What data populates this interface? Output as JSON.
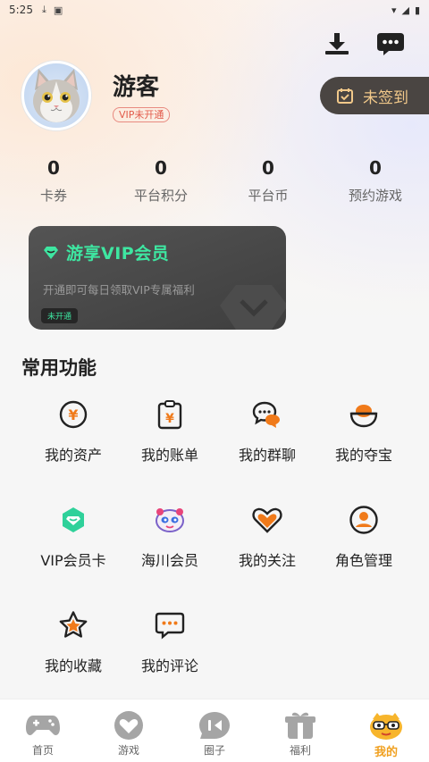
{
  "status_bar": {
    "time": "5:25"
  },
  "profile": {
    "username": "游客",
    "vip_tag": "VIP未开通",
    "checkin_label": "未签到"
  },
  "stats": [
    {
      "value": "0",
      "label": "卡券"
    },
    {
      "value": "0",
      "label": "平台积分"
    },
    {
      "value": "0",
      "label": "平台币"
    },
    {
      "value": "0",
      "label": "预约游戏"
    }
  ],
  "vip_card": {
    "title": "游享VIP会员",
    "desc": "开通即可每日领取VIP专属福利",
    "state": "未开通"
  },
  "section": {
    "title": "常用功能"
  },
  "features": [
    {
      "label": "我的资产",
      "icon": "yuan-coin-icon"
    },
    {
      "label": "我的账单",
      "icon": "bill-icon"
    },
    {
      "label": "我的群聊",
      "icon": "group-chat-icon"
    },
    {
      "label": "我的夺宝",
      "icon": "treasure-icon"
    },
    {
      "label": "VIP会员卡",
      "icon": "vip-card-icon"
    },
    {
      "label": "海川会员",
      "icon": "haichuan-member-icon"
    },
    {
      "label": "我的关注",
      "icon": "heart-icon"
    },
    {
      "label": "角色管理",
      "icon": "user-icon"
    },
    {
      "label": "我的收藏",
      "icon": "star-icon"
    },
    {
      "label": "我的评论",
      "icon": "comment-icon"
    }
  ],
  "tabs": [
    {
      "label": "首页",
      "icon": "gamepad-icon"
    },
    {
      "label": "游戏",
      "icon": "game-heart-icon"
    },
    {
      "label": "圈子",
      "icon": "circle-icon"
    },
    {
      "label": "福利",
      "icon": "gift-icon"
    },
    {
      "label": "我的",
      "icon": "mascot-icon",
      "active": true
    }
  ],
  "colors": {
    "accent": "#f07a1a",
    "vip_green": "#3ee6a1",
    "active_tab": "#f0a020"
  }
}
